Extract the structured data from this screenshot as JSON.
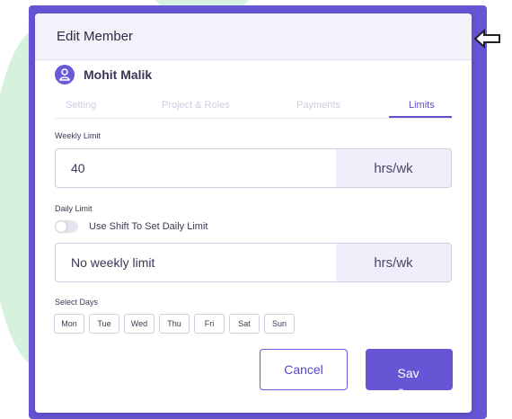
{
  "modal": {
    "title": "Edit Member"
  },
  "member": {
    "name": "Mohit Malik",
    "avatar_icon": "user-icon"
  },
  "tabs": [
    {
      "label": "Setting",
      "active": false
    },
    {
      "label": "Project & Roles",
      "active": false
    },
    {
      "label": "Payments",
      "active": false
    },
    {
      "label": "Limits",
      "active": true
    }
  ],
  "weekly_limit": {
    "label": "Weekly Limit",
    "value": "40",
    "unit": "hrs/wk"
  },
  "daily_limit": {
    "label": "Daily Limit",
    "toggle_label": "Use Shift To Set Daily Limit",
    "toggle_on": false,
    "value": "No weekly limit",
    "unit": "hrs/wk"
  },
  "select_days": {
    "label": "Select Days",
    "days": [
      "Mon",
      "Tue",
      "Wed",
      "Thu",
      "Fri",
      "Sat",
      "Sun"
    ]
  },
  "actions": {
    "cancel_label": "Cancel",
    "save_label": "Save"
  },
  "colors": {
    "accent": "#6656d6",
    "header_bg": "#f3f2fb",
    "unit_bg": "#efeefa",
    "decor_green": "#d6f2df"
  }
}
